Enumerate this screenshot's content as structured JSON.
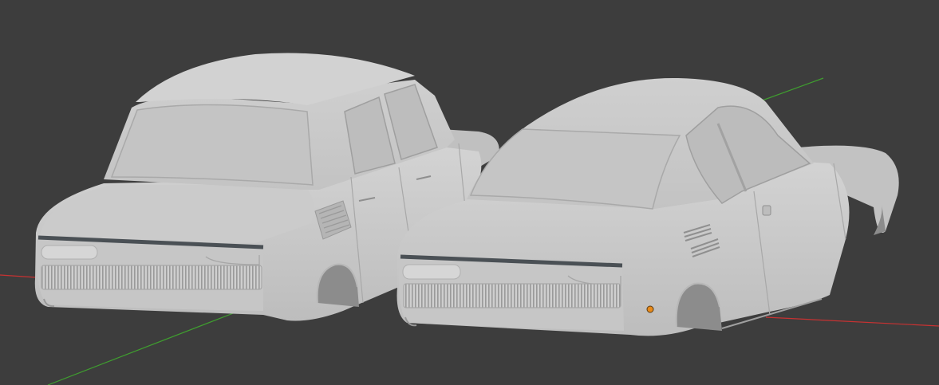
{
  "viewport": {
    "background": "#3d3d3d",
    "x_axis_color": "#c83232",
    "y_axis_color": "#3f9f2f",
    "model_color": "#c8c8c8",
    "origin_marker_color": "#e88a1a"
  },
  "models": [
    {
      "name": "sedan"
    },
    {
      "name": "coupe"
    }
  ]
}
